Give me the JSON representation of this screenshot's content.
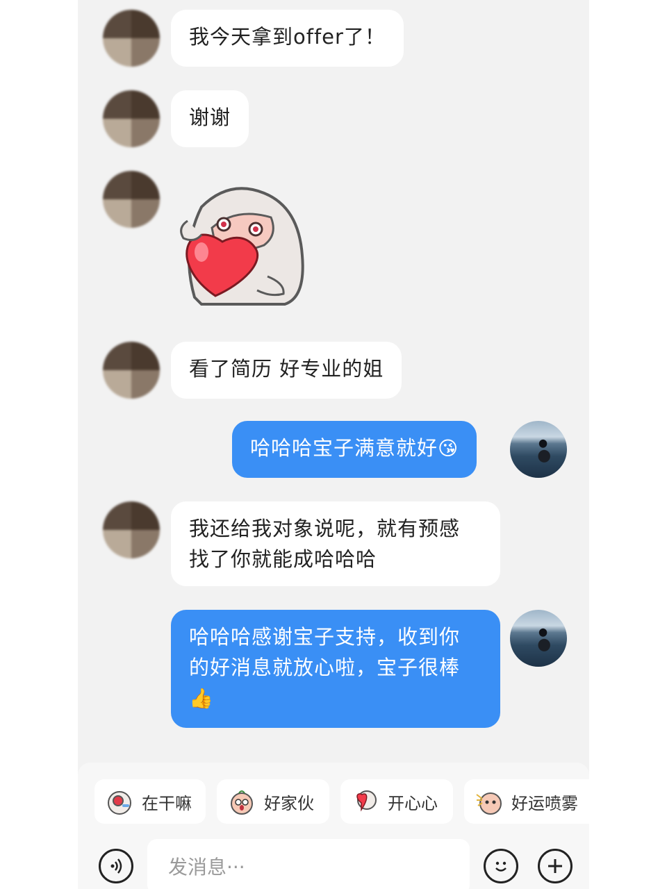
{
  "messages": [
    {
      "from": "other",
      "text": "我今天拿到offer了！"
    },
    {
      "from": "other",
      "text": "谢谢"
    },
    {
      "from": "other",
      "sticker": "heart-hug-sticker"
    },
    {
      "from": "other",
      "text": "看了简历  好专业的姐"
    },
    {
      "from": "me",
      "text": "哈哈哈宝子满意就好",
      "emoji": "😘"
    },
    {
      "from": "other",
      "lines": [
        "我还给我对象说呢，就有预感",
        "找了你就能成哈哈哈"
      ]
    },
    {
      "from": "me",
      "lines": [
        "哈哈哈感谢宝子支持，收到你",
        "的好消息就放心啦，宝子很棒"
      ],
      "emoji": "👍"
    }
  ],
  "quick_replies": [
    {
      "label": "在干嘛",
      "icon": "microphone-sticker-icon"
    },
    {
      "label": "好家伙",
      "icon": "surprised-face-sticker-icon"
    },
    {
      "label": "开心心",
      "icon": "heart-sticker-icon"
    },
    {
      "label": "好运喷雾",
      "icon": "spray-sticker-icon"
    }
  ],
  "input": {
    "placeholder": "发消息···"
  },
  "colors": {
    "my_bubble": "#3a8ff5",
    "other_bubble": "#ffffff",
    "background": "#f2f2f2"
  }
}
